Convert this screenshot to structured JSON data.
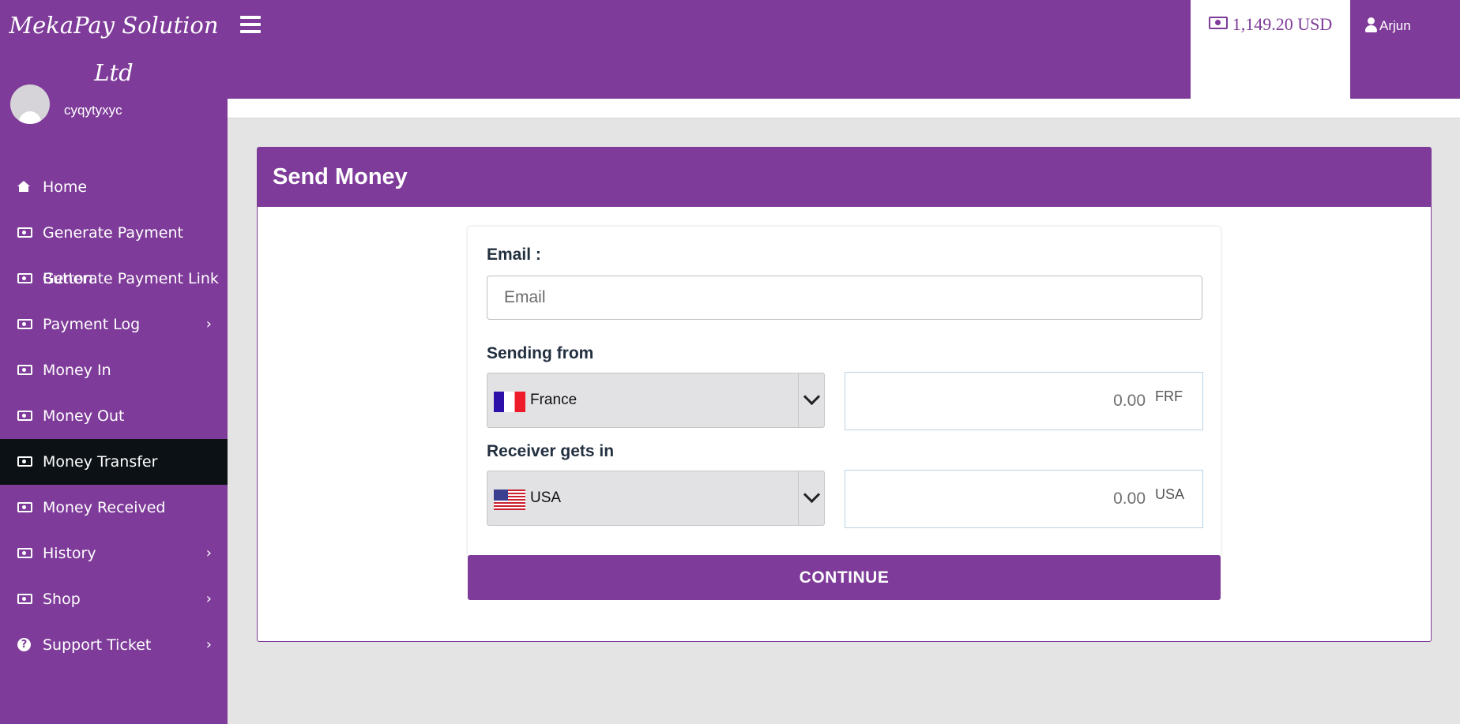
{
  "header": {
    "brand_line1": "MekaPay Solution",
    "brand_line2": "Ltd",
    "balance": "1,149.20 USD",
    "user_name": "Arjun"
  },
  "sidebar": {
    "username": "cyqytyxyc",
    "items": [
      {
        "label": "Home",
        "icon": "home-icon",
        "has_submenu": false
      },
      {
        "label": "Generate Payment Button",
        "icon": "money-icon",
        "has_submenu": false
      },
      {
        "label": "Generate Payment Link",
        "icon": "money-icon",
        "has_submenu": false
      },
      {
        "label": "Payment Log",
        "icon": "money-icon",
        "has_submenu": true
      },
      {
        "label": "Money In",
        "icon": "money-icon",
        "has_submenu": false
      },
      {
        "label": "Money Out",
        "icon": "money-icon",
        "has_submenu": false
      },
      {
        "label": "Money Transfer",
        "icon": "money-icon",
        "has_submenu": false,
        "active": true
      },
      {
        "label": "Money Received",
        "icon": "money-icon",
        "has_submenu": false
      },
      {
        "label": "History",
        "icon": "money-icon",
        "has_submenu": true
      },
      {
        "label": "Shop",
        "icon": "money-icon",
        "has_submenu": true
      },
      {
        "label": "Support Ticket",
        "icon": "question-circle-icon",
        "has_submenu": true
      }
    ]
  },
  "main": {
    "title": "Send Money",
    "email_label": "Email :",
    "email_placeholder": "Email",
    "email_value": "",
    "sending_from_label": "Sending from",
    "sending_from_country": "France",
    "sending_amount": "0.00",
    "sending_currency": "FRF",
    "receiver_label": "Receiver gets in",
    "receiver_country": "USA",
    "receiver_amount": "0.00",
    "receiver_currency": "USA",
    "continue_label": "CONTINUE"
  },
  "colors": {
    "brand": "#7e3b99",
    "active_nav": "#0c1115",
    "background": "#e5e4e5"
  }
}
